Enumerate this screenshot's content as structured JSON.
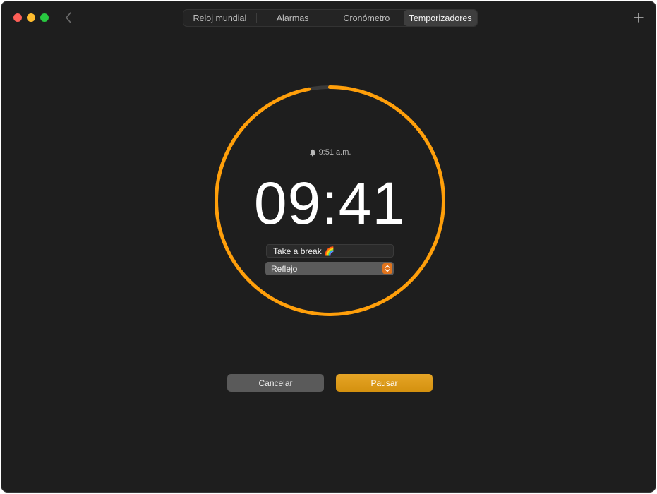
{
  "window": {
    "tabs": [
      {
        "label": "Reloj mundial",
        "active": false
      },
      {
        "label": "Alarmas",
        "active": false
      },
      {
        "label": "Cronómetro",
        "active": false
      },
      {
        "label": "Temporizadores",
        "active": true
      }
    ],
    "icons": {
      "back": "chevron-left-icon",
      "add": "plus-icon",
      "bell": "bell-icon",
      "select": "up-down-arrows-icon"
    }
  },
  "timer": {
    "alarm_time": "9:51 a.m.",
    "remaining": "09:41",
    "label": "Take a break 🌈",
    "sound": "Reflejo",
    "progress_remaining": 0.97
  },
  "actions": {
    "cancel": "Cancelar",
    "pause": "Pausar"
  },
  "colors": {
    "accent": "#FF9F0A",
    "track": "#3A3A3A",
    "window_bg": "#1E1E1E",
    "pause_button": "#D99A1C",
    "cancel_button": "#5A5A5A",
    "select_stepper": "#E0731C"
  }
}
